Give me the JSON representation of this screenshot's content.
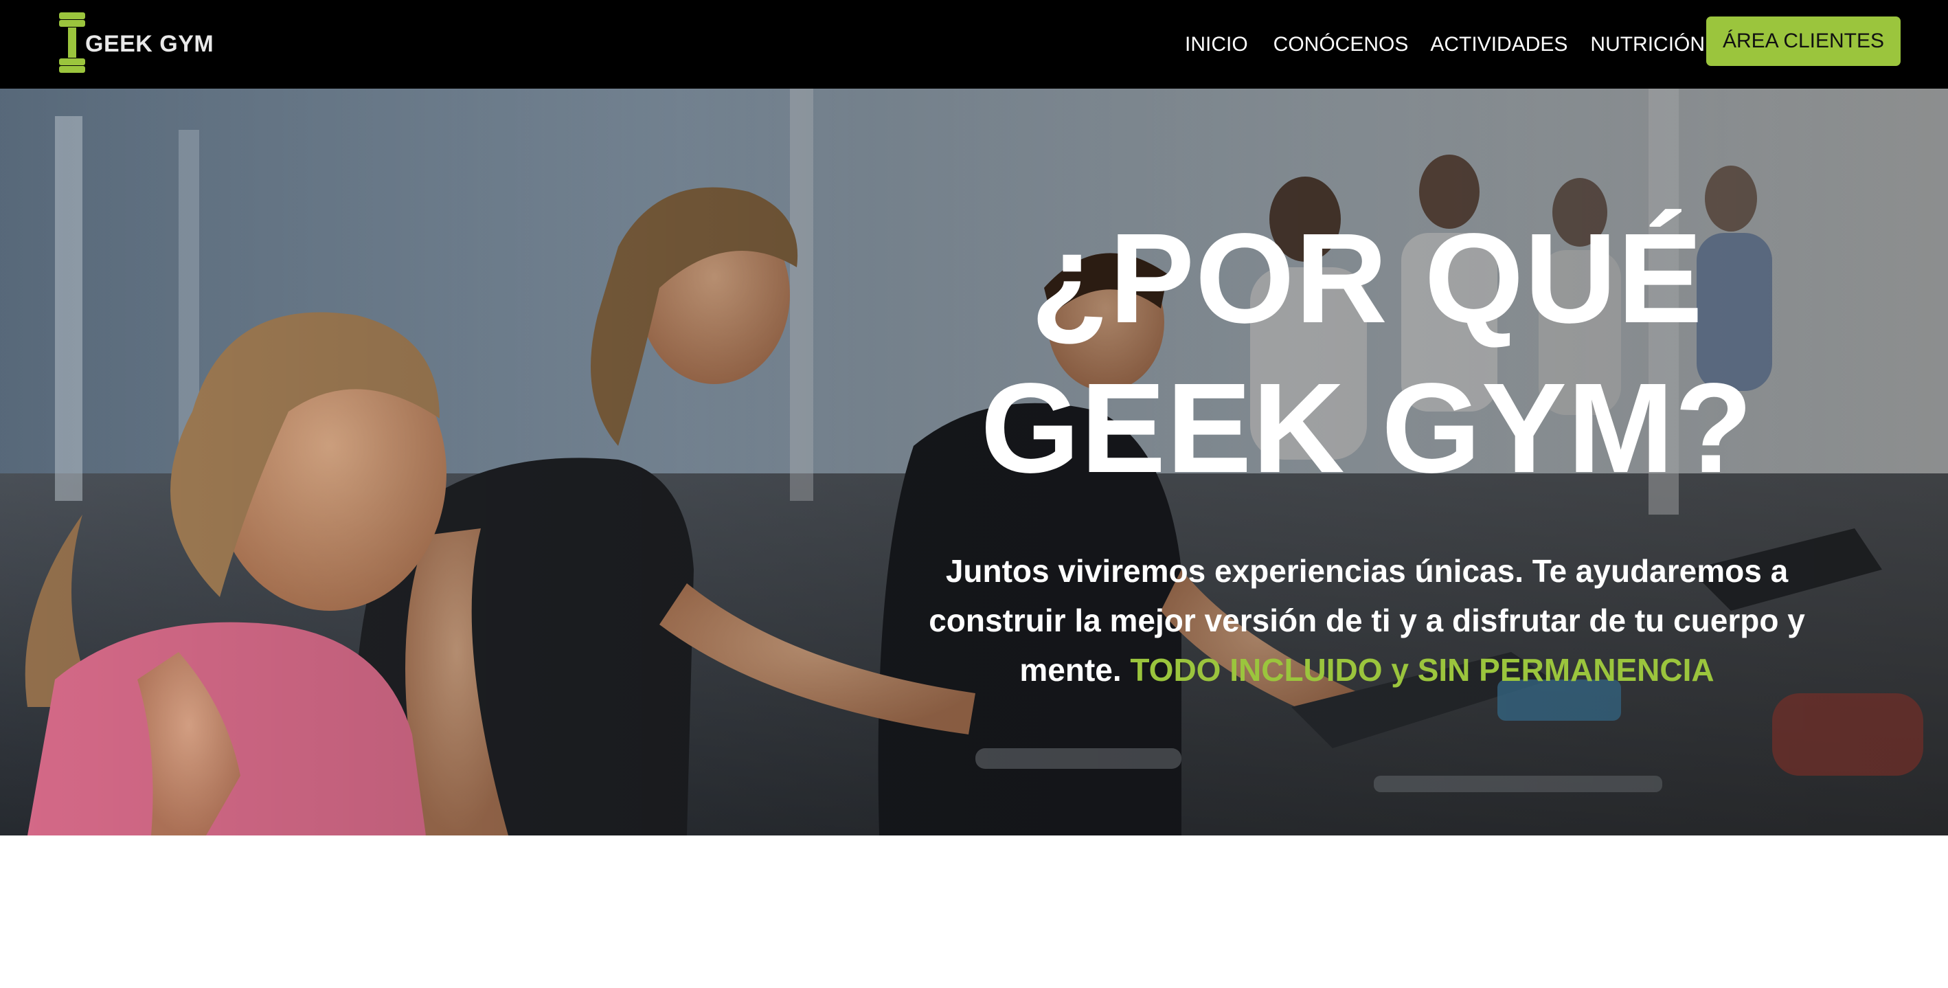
{
  "brand": {
    "name": "GEEK GYM",
    "accent_color": "#9bc53d",
    "logo_icon": "dumbbell-icon"
  },
  "nav": {
    "items": [
      {
        "label": "INICIO"
      },
      {
        "label": "CONÓCENOS"
      },
      {
        "label": "ACTIVIDADES"
      },
      {
        "label": "NUTRICIÓN"
      }
    ],
    "cta_label": "ÁREA CLIENTES"
  },
  "hero": {
    "title_line1": "¿POR QUÉ",
    "title_line2": "GEEK GYM?",
    "text": "Juntos viviremos experiencias únicas. Te ayudaremos a construir la mejor versión de ti y a disfrutar de tu cuerpo y mente.",
    "highlight": "TODO INCLUIDO y SIN PERMANENCIA"
  }
}
